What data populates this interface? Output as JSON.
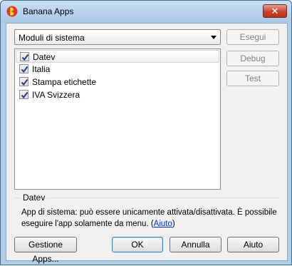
{
  "window": {
    "title": "Banana Apps",
    "close_label": "✕"
  },
  "combo": {
    "selected": "Moduli di sistema"
  },
  "side_buttons": {
    "run": "Esegui",
    "debug": "Debug",
    "test": "Test"
  },
  "list": {
    "items": [
      {
        "label": "Datev",
        "checked": true,
        "selected": true
      },
      {
        "label": "Italia",
        "checked": true,
        "selected": false
      },
      {
        "label": "Stampa etichette",
        "checked": true,
        "selected": false
      },
      {
        "label": "IVA Svizzera",
        "checked": true,
        "selected": false
      }
    ]
  },
  "info": {
    "title": "Datev",
    "line1": "App di sistema: può essere unicamente attivata/disattivata. È possibile",
    "line2_prefix": "eseguire l'app solamente da menu. (",
    "link": "Aiuto",
    "line2_suffix": ")"
  },
  "bottom_buttons": {
    "manage": "Gestione Apps...",
    "ok": "OK",
    "cancel": "Annulla",
    "help": "Aiuto"
  },
  "colors": {
    "accent": "#3c7fb1",
    "link": "#0033cc",
    "close": "#c8432b"
  }
}
